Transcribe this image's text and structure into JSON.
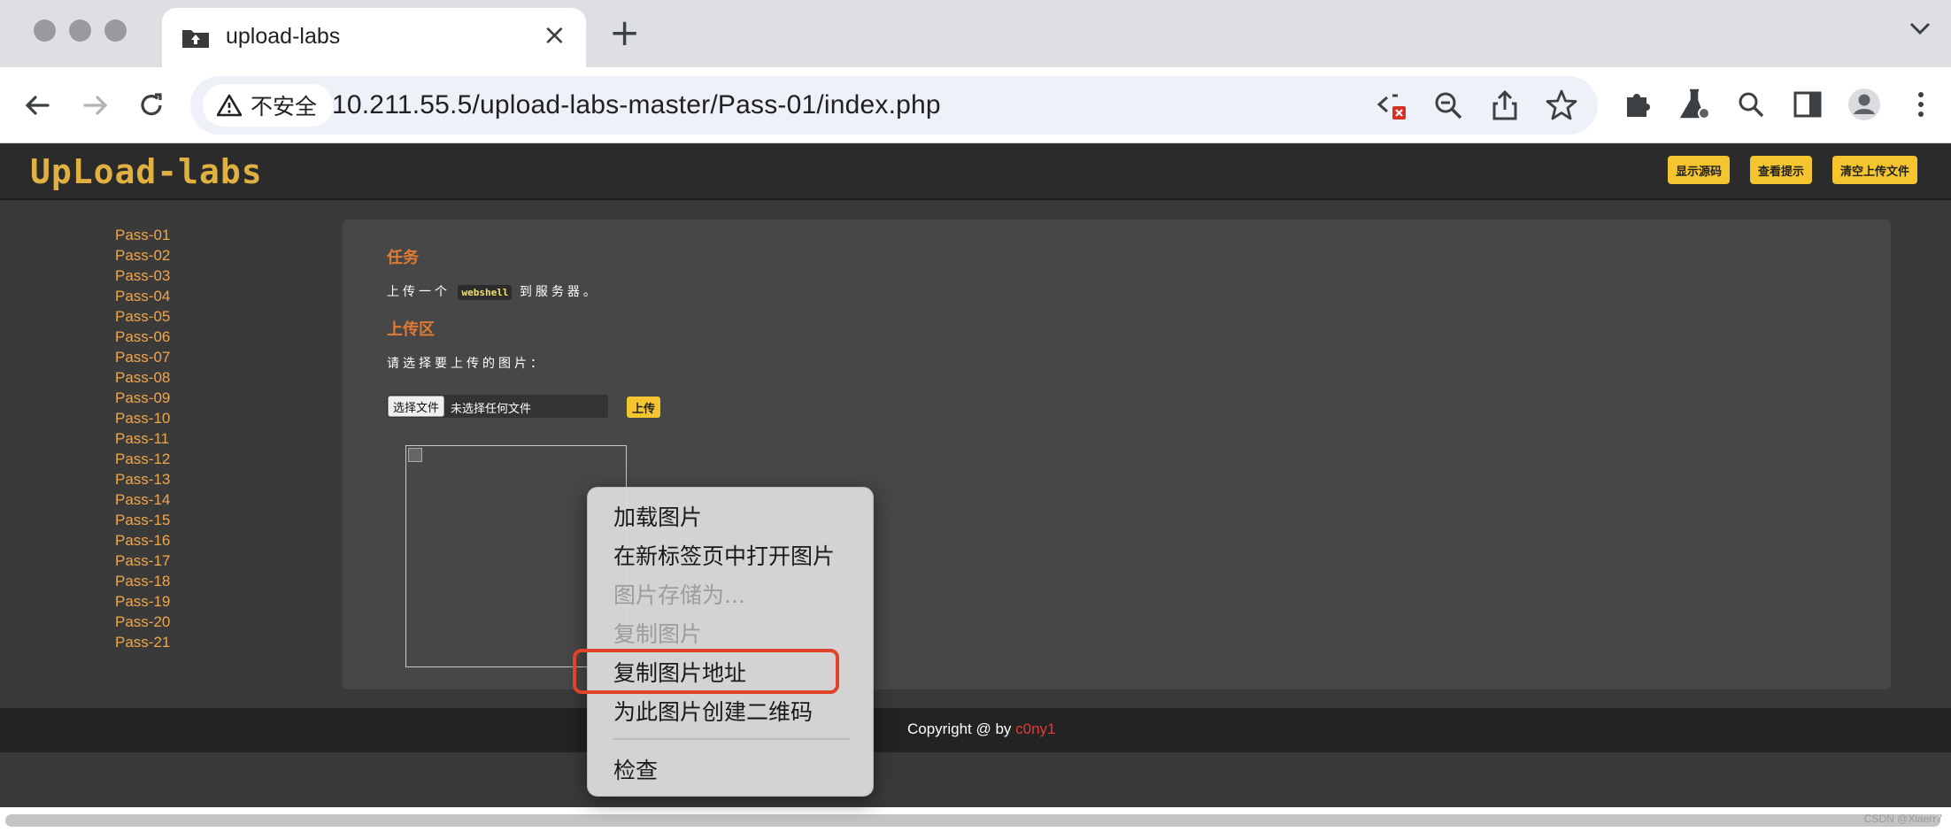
{
  "browser": {
    "tab_title": "upload-labs",
    "security_label": "不安全",
    "url": "10.211.55.5/upload-labs-master/Pass-01/index.php"
  },
  "site": {
    "logo": "UpLoad-labs",
    "header_buttons": [
      "显示源码",
      "查看提示",
      "清空上传文件"
    ],
    "passes": [
      "Pass-01",
      "Pass-02",
      "Pass-03",
      "Pass-04",
      "Pass-05",
      "Pass-06",
      "Pass-07",
      "Pass-08",
      "Pass-09",
      "Pass-10",
      "Pass-11",
      "Pass-12",
      "Pass-13",
      "Pass-14",
      "Pass-15",
      "Pass-16",
      "Pass-17",
      "Pass-18",
      "Pass-19",
      "Pass-20",
      "Pass-21"
    ],
    "task_heading": "任务",
    "task_before": "上传一个",
    "task_code": "webshell",
    "task_after": "到服务器。",
    "upload_heading": "上传区",
    "upload_prompt": "请选择要上传的图片：",
    "choose_file": "选择文件",
    "no_file": "未选择任何文件",
    "upload_button": "上传",
    "copyright_prefix": "Copyright @  by ",
    "copyright_author": "c0ny1",
    "watermark": "CSDN @Xiaerr7"
  },
  "context_menu": {
    "items": [
      {
        "label": "加载图片",
        "enabled": true
      },
      {
        "label": "在新标签页中打开图片",
        "enabled": true
      },
      {
        "label": "图片存储为...",
        "enabled": false
      },
      {
        "label": "复制图片",
        "enabled": false
      },
      {
        "label": "复制图片地址",
        "enabled": true,
        "highlighted": true
      },
      {
        "label": "为此图片创建二维码",
        "enabled": true
      },
      {
        "label": "检查",
        "enabled": true
      }
    ]
  },
  "colors": {
    "accent_yellow": "#f5c530",
    "link_orange": "#f0a64a",
    "heading_orange": "#e07a35",
    "highlight_red": "#e0422a"
  }
}
